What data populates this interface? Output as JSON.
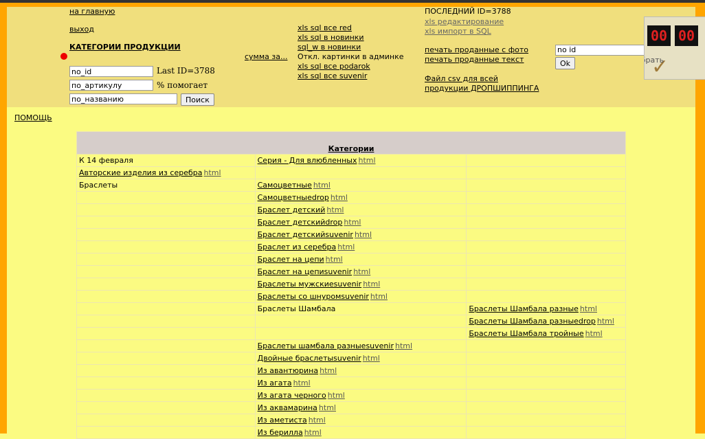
{
  "header": {
    "nav_home": "на главную",
    "nav_exit": "выход",
    "categories_title": "КАТЕГОРИИ ПРОДУКЦИИ",
    "field_id": "no_id",
    "field_article": "по_артикулу",
    "field_name": "по_названию",
    "last_id_note": "Last ID=3788",
    "percent_note": "% помогает",
    "search_button": "Поиск",
    "sum_link": "сумма за...",
    "xls_links": [
      "xls sql все red",
      "xls sql в новинки",
      "sql_w в новинки",
      "Откл. картинки в админке",
      "xls sql все podarok",
      "xls sql все suvenir"
    ],
    "last_id_title": "ПОСЛЕДНИЙ ID=3788",
    "xls_edit": "xls редактирование",
    "xls_import": "xls импорт в SQL",
    "print_photo": "печать проданные с фото",
    "print_text": "печать проданные текст",
    "csv_line1": "Файл csv для всей",
    "csv_line2": "продукции ДРОПШИППИНГА",
    "select_value": "no id",
    "ok_button": "Ok"
  },
  "timer": {
    "d1": "00",
    "d2": "00",
    "label": "Убрать"
  },
  "help_link": "ПОМОЩЬ",
  "table": {
    "title": "Категории",
    "html_label": "html",
    "rows": [
      {
        "c1": "К 14 февраля",
        "c1_link": false,
        "c1_html": false,
        "c2": "Серия - Для влюбленных",
        "c2_html": true,
        "c3": "",
        "c3_html": false
      },
      {
        "c1": "Авторские изделия из серебра",
        "c1_link": true,
        "c1_html": true,
        "c2": "",
        "c2_html": false,
        "c3": "",
        "c3_html": false
      },
      {
        "c1": "Браслеты",
        "c1_link": false,
        "c1_html": false,
        "c2": "Самоцветные",
        "c2_html": true,
        "c3": "",
        "c3_html": false
      },
      {
        "c1": "",
        "c1_link": false,
        "c1_html": false,
        "c2": "Самоцветныеdrop",
        "c2_html": true,
        "c3": "",
        "c3_html": false
      },
      {
        "c1": "",
        "c1_link": false,
        "c1_html": false,
        "c2": "Браслет детский",
        "c2_html": true,
        "c3": "",
        "c3_html": false
      },
      {
        "c1": "",
        "c1_link": false,
        "c1_html": false,
        "c2": "Браслет детскийdrop",
        "c2_html": true,
        "c3": "",
        "c3_html": false
      },
      {
        "c1": "",
        "c1_link": false,
        "c1_html": false,
        "c2": "Браслет детскийsuvenir",
        "c2_html": true,
        "c3": "",
        "c3_html": false
      },
      {
        "c1": "",
        "c1_link": false,
        "c1_html": false,
        "c2": "Браслет из серебра",
        "c2_html": true,
        "c3": "",
        "c3_html": false
      },
      {
        "c1": "",
        "c1_link": false,
        "c1_html": false,
        "c2": "Браслет на цепи",
        "c2_html": true,
        "c3": "",
        "c3_html": false
      },
      {
        "c1": "",
        "c1_link": false,
        "c1_html": false,
        "c2": "Браслет на цепиsuvenir",
        "c2_html": true,
        "c3": "",
        "c3_html": false
      },
      {
        "c1": "",
        "c1_link": false,
        "c1_html": false,
        "c2": "Браслеты мужскиеsuvenir",
        "c2_html": true,
        "c3": "",
        "c3_html": false
      },
      {
        "c1": "",
        "c1_link": false,
        "c1_html": false,
        "c2": "Браслеты со шнуромsuvenir",
        "c2_html": true,
        "c3": "",
        "c3_html": false
      },
      {
        "c1": "",
        "c1_link": false,
        "c1_html": false,
        "c2": "Браслеты Шамбала",
        "c2_plain": true,
        "c2_html": false,
        "c3": "Браслеты Шамбала разные",
        "c3_html": true
      },
      {
        "c1": "",
        "c1_link": false,
        "c1_html": false,
        "c2": "",
        "c2_html": false,
        "c3": "Браслеты Шамбала разныеdrop",
        "c3_html": true
      },
      {
        "c1": "",
        "c1_link": false,
        "c1_html": false,
        "c2": "",
        "c2_html": false,
        "c3": "Браслеты Шамбала тройные",
        "c3_html": true
      },
      {
        "c1": "",
        "c1_link": false,
        "c1_html": false,
        "c2": "Браслеты шамбала разныеsuvenir",
        "c2_html": true,
        "c3": "",
        "c3_html": false
      },
      {
        "c1": "",
        "c1_link": false,
        "c1_html": false,
        "c2": "Двойные браслетыsuvenir",
        "c2_html": true,
        "c3": "",
        "c3_html": false
      },
      {
        "c1": "",
        "c1_link": false,
        "c1_html": false,
        "c2": "Из авантюрина",
        "c2_html": true,
        "c3": "",
        "c3_html": false
      },
      {
        "c1": "",
        "c1_link": false,
        "c1_html": false,
        "c2": "Из агата",
        "c2_html": true,
        "c3": "",
        "c3_html": false
      },
      {
        "c1": "",
        "c1_link": false,
        "c1_html": false,
        "c2": "Из агата черного",
        "c2_html": true,
        "c3": "",
        "c3_html": false
      },
      {
        "c1": "",
        "c1_link": false,
        "c1_html": false,
        "c2": "Из аквамарина",
        "c2_html": true,
        "c3": "",
        "c3_html": false
      },
      {
        "c1": "",
        "c1_link": false,
        "c1_html": false,
        "c2": "Из аметиста",
        "c2_html": true,
        "c3": "",
        "c3_html": false
      },
      {
        "c1": "",
        "c1_link": false,
        "c1_html": false,
        "c2": "Из берилла",
        "c2_html": true,
        "c3": "",
        "c3_html": false
      }
    ]
  },
  "colors": {
    "page_bg": "#FBFB82",
    "header_bg": "#F0DF7D",
    "frame": "#FFA500",
    "table_header": "#D6CDCA",
    "indicator": "#E00000"
  }
}
